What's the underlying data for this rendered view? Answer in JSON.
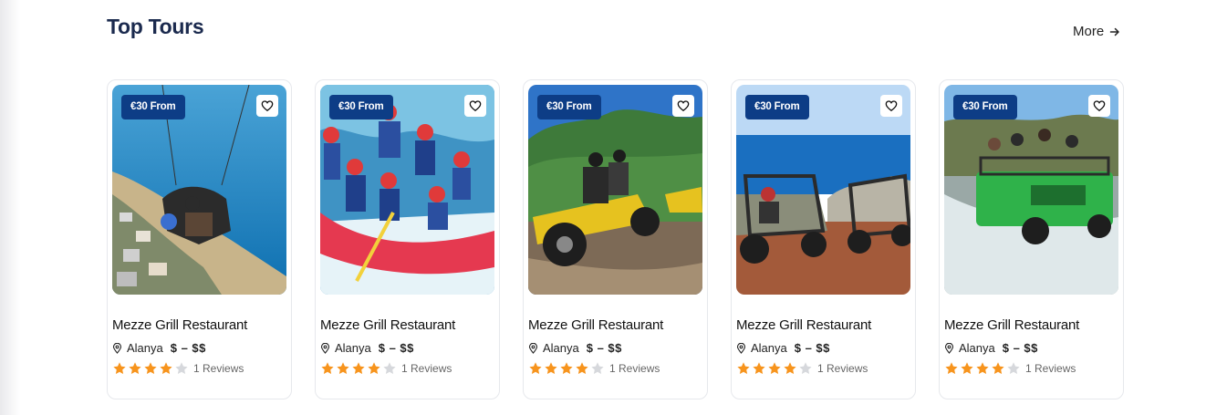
{
  "section": {
    "title": "Top Tours",
    "more_label": "More"
  },
  "colors": {
    "accent": "#0d3d86",
    "star_filled": "#f7941d",
    "star_empty": "#d6d8dc",
    "title": "#1b2a4e"
  },
  "cards": [
    {
      "badge": "€30 From",
      "title": "Mezze Grill Restaurant",
      "location": "Alanya",
      "price_range": "$ – $$",
      "rating": 4,
      "rating_max": 5,
      "reviews": "1 Reviews",
      "image": "paragliding-photo"
    },
    {
      "badge": "€30 From",
      "title": "Mezze Grill Restaurant",
      "location": "Alanya",
      "price_range": "$ – $$",
      "rating": 4,
      "rating_max": 5,
      "reviews": "1 Reviews",
      "image": "rafting-photo"
    },
    {
      "badge": "€30 From",
      "title": "Mezze Grill Restaurant",
      "location": "Alanya",
      "price_range": "$ – $$",
      "rating": 4,
      "rating_max": 5,
      "reviews": "1 Reviews",
      "image": "quad-bike-photo"
    },
    {
      "badge": "€30 From",
      "title": "Mezze Grill Restaurant",
      "location": "Alanya",
      "price_range": "$ – $$",
      "rating": 4,
      "rating_max": 5,
      "reviews": "1 Reviews",
      "image": "buggy-photo"
    },
    {
      "badge": "€30 From",
      "title": "Mezze Grill Restaurant",
      "location": "Alanya",
      "price_range": "$ – $$",
      "rating": 4,
      "rating_max": 5,
      "reviews": "1 Reviews",
      "image": "jeep-safari-photo"
    }
  ]
}
